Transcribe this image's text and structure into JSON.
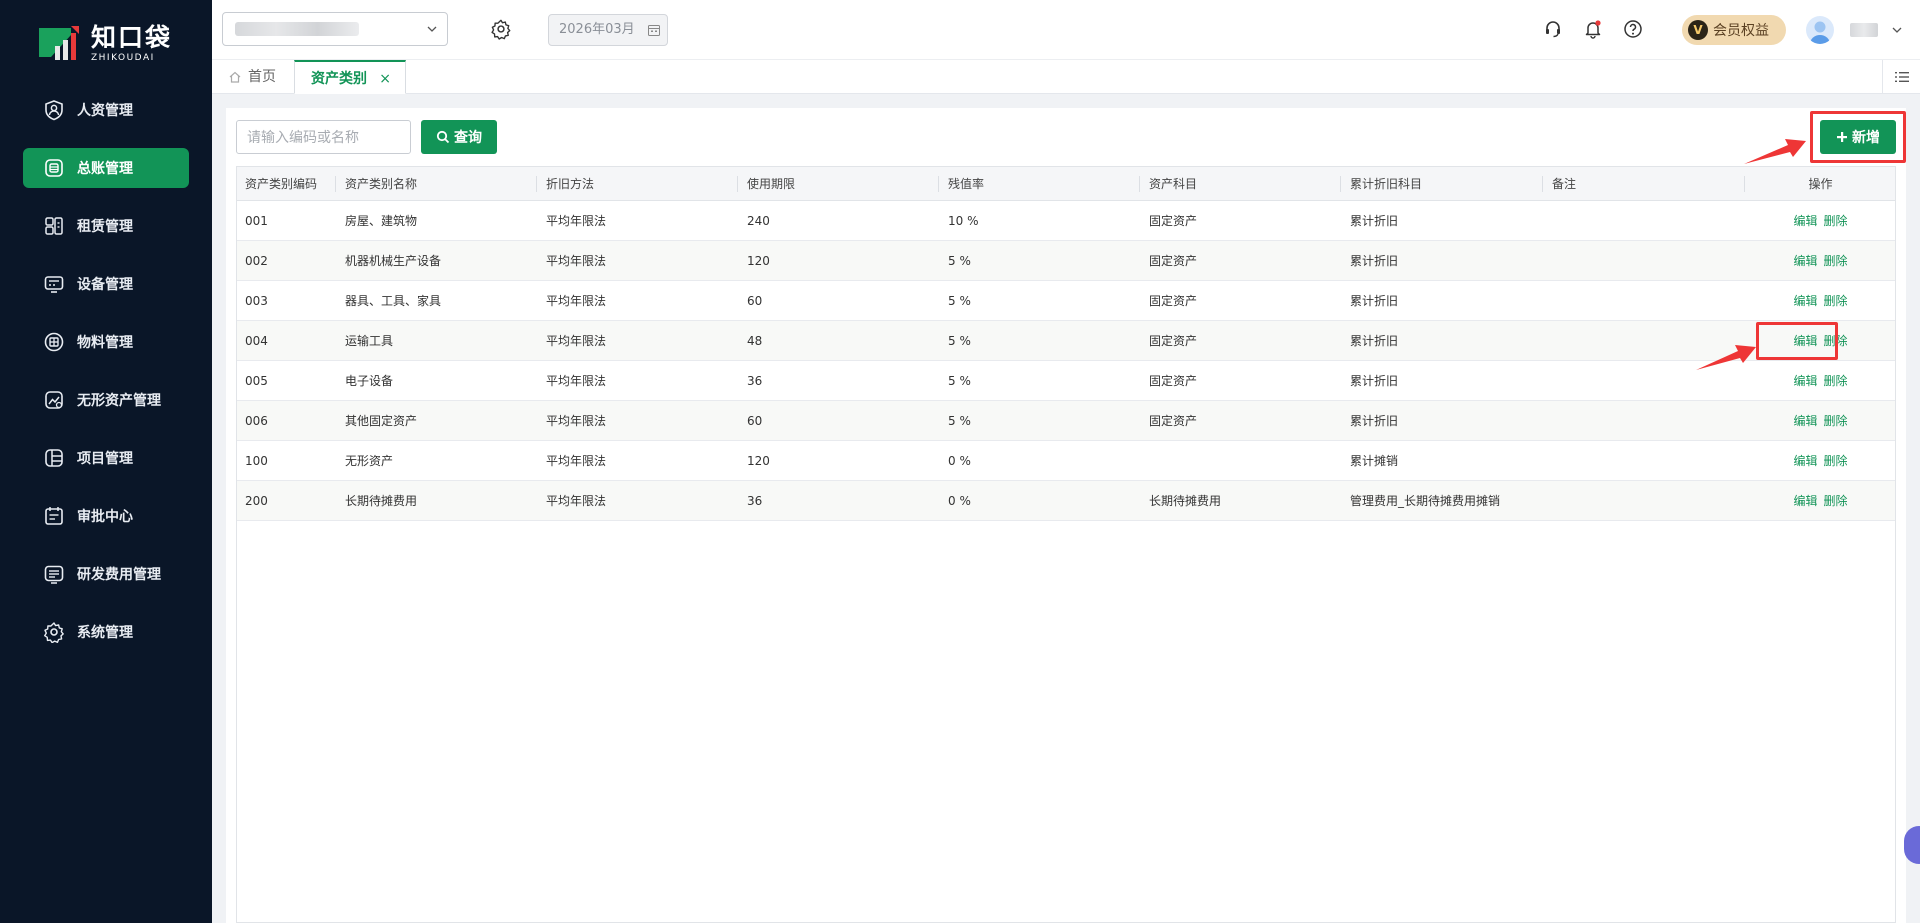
{
  "app": {
    "logo_cn": "知口袋",
    "logo_en": "ZHIKOUDAI",
    "brand_color": "#129457",
    "sidebar_bg": "#0a1628",
    "highlight_color": "#ee3636"
  },
  "sidebar": {
    "items": [
      {
        "label": "人资管理",
        "icon": "person-shield-icon"
      },
      {
        "label": "总账管理",
        "icon": "ledger-icon",
        "active": true
      },
      {
        "label": "租赁管理",
        "icon": "lease-icon"
      },
      {
        "label": "设备管理",
        "icon": "device-icon"
      },
      {
        "label": "物料管理",
        "icon": "materials-icon"
      },
      {
        "label": "无形资产管理",
        "icon": "intangible-asset-icon"
      },
      {
        "label": "项目管理",
        "icon": "project-icon"
      },
      {
        "label": "审批中心",
        "icon": "approval-icon"
      },
      {
        "label": "研发费用管理",
        "icon": "rd-expense-icon"
      },
      {
        "label": "系统管理",
        "icon": "gear-icon"
      }
    ]
  },
  "topbar": {
    "month": "2026年03月",
    "vip_badge": "V",
    "vip_label": "会员权益"
  },
  "tabs": {
    "home": "首页",
    "active": "资产类别",
    "close": "×"
  },
  "toolbar": {
    "search_placeholder": "请输入编码或名称",
    "query_label": "查询",
    "add_label": "新增"
  },
  "table": {
    "columns": [
      "资产类别编码",
      "资产类别名称",
      "折旧方法",
      "使用期限",
      "残值率",
      "资产科目",
      "累计折旧科目",
      "备注",
      "操作"
    ],
    "edit_label": "编辑",
    "delete_label": "删除",
    "rows": [
      {
        "code": "001",
        "name": "房屋、建筑物",
        "method": "平均年限法",
        "term": "240",
        "residual": "10 %",
        "asset_account": "固定资产",
        "dep_account": "累计折旧",
        "note": ""
      },
      {
        "code": "002",
        "name": "机器机械生产设备",
        "method": "平均年限法",
        "term": "120",
        "residual": "5 %",
        "asset_account": "固定资产",
        "dep_account": "累计折旧",
        "note": ""
      },
      {
        "code": "003",
        "name": "器具、工具、家具",
        "method": "平均年限法",
        "term": "60",
        "residual": "5 %",
        "asset_account": "固定资产",
        "dep_account": "累计折旧",
        "note": ""
      },
      {
        "code": "004",
        "name": "运输工具",
        "method": "平均年限法",
        "term": "48",
        "residual": "5 %",
        "asset_account": "固定资产",
        "dep_account": "累计折旧",
        "note": ""
      },
      {
        "code": "005",
        "name": "电子设备",
        "method": "平均年限法",
        "term": "36",
        "residual": "5 %",
        "asset_account": "固定资产",
        "dep_account": "累计折旧",
        "note": ""
      },
      {
        "code": "006",
        "name": "其他固定资产",
        "method": "平均年限法",
        "term": "60",
        "residual": "5 %",
        "asset_account": "固定资产",
        "dep_account": "累计折旧",
        "note": ""
      },
      {
        "code": "100",
        "name": "无形资产",
        "method": "平均年限法",
        "term": "120",
        "residual": "0 %",
        "asset_account": "",
        "dep_account": "累计摊销",
        "note": ""
      },
      {
        "code": "200",
        "name": "长期待摊费用",
        "method": "平均年限法",
        "term": "36",
        "residual": "0 %",
        "asset_account": "长期待摊费用",
        "dep_account": "管理费用_长期待摊费用摊销",
        "note": ""
      }
    ]
  }
}
